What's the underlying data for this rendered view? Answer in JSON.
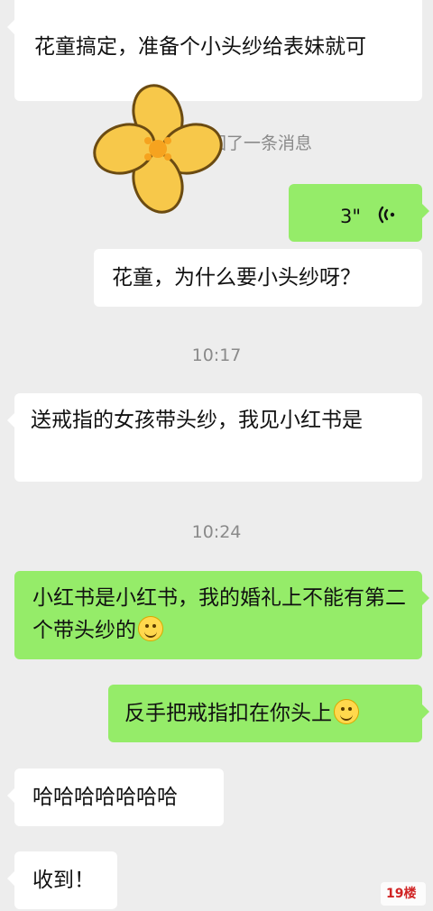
{
  "messages": [
    {
      "side": "left",
      "text": "花童搞定，准备个小头纱给表妹就可"
    },
    {
      "side": "system",
      "text": "回了一条消息"
    },
    {
      "side": "right",
      "type": "voice",
      "duration": "3\""
    },
    {
      "side": "left",
      "text": "花童，为什么要小头纱呀？"
    },
    {
      "side": "time",
      "text": "10:17"
    },
    {
      "side": "left",
      "text": "送戒指的女孩带头纱，我见小红书是"
    },
    {
      "side": "time",
      "text": "10:24"
    },
    {
      "side": "right",
      "text": "小红书是小红书，我的婚礼上不能有第二个带头纱的"
    },
    {
      "side": "right",
      "text": "反手把戒指扣在你头上"
    },
    {
      "side": "left",
      "text": "哈哈哈哈哈哈哈"
    },
    {
      "side": "left",
      "text": "收到！"
    }
  ],
  "watermark": {
    "text": "19楼"
  },
  "icons": {
    "voice": "voice-wave-icon",
    "emoji": "smile-emoji-icon",
    "sticker": "yellow-flower-sticker"
  },
  "colors": {
    "background": "#ededed",
    "sent_bubble": "#95ec69",
    "received_bubble": "#ffffff",
    "time_text": "#8a8a8a"
  }
}
